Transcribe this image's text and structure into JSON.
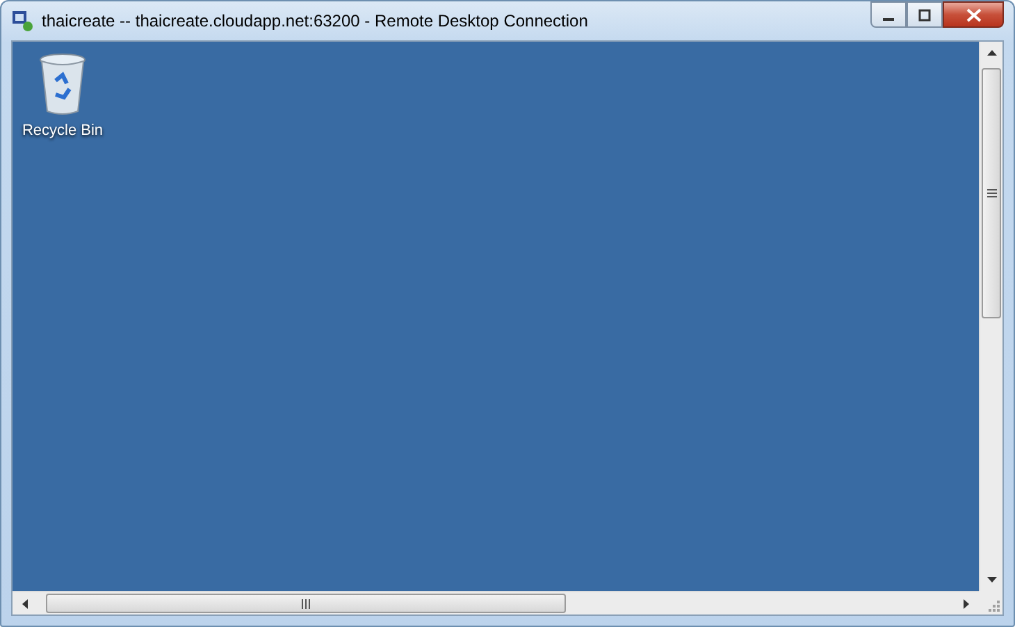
{
  "window": {
    "title": "thaicreate -- thaicreate.cloudapp.net:63200 - Remote Desktop Connection"
  },
  "desktop": {
    "icons": [
      {
        "label": "Recycle Bin"
      }
    ]
  }
}
